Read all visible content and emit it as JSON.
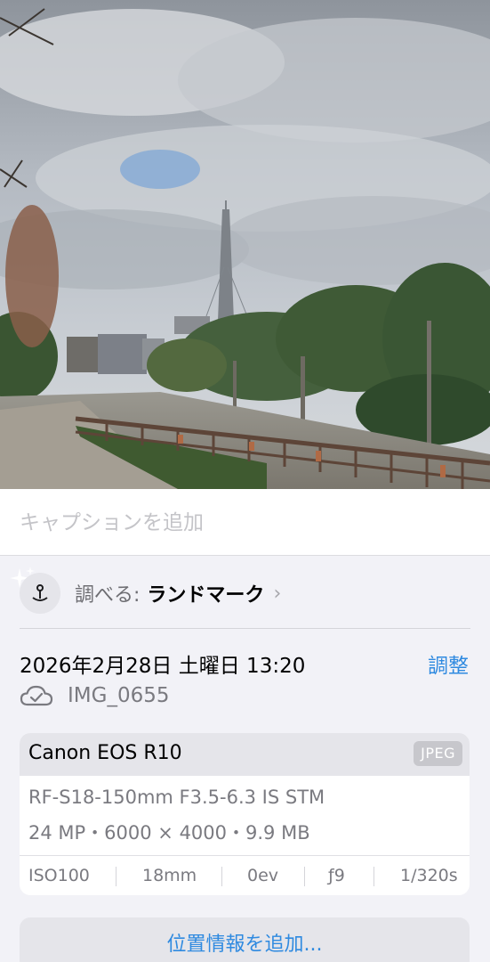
{
  "caption": {
    "placeholder": "キャプションを追加"
  },
  "lookup": {
    "prefix": "調べる:",
    "value": "ランドマーク",
    "chevron": "›",
    "icon": "landmark-pin-icon"
  },
  "metadata": {
    "datetime": "2026年2月28日 土曜日 13:20",
    "adjust_label": "調整",
    "file_name": "IMG_0655",
    "sync_icon": "icloud-icon"
  },
  "camera": {
    "model": "Canon EOS R10",
    "format": "JPEG",
    "lens": "RF-S18-150mm F3.5-6.3 IS STM",
    "specs": "24 MP・6000 × 4000・9.9 MB",
    "exif": {
      "iso": "ISO100",
      "focal_length": "18mm",
      "exposure_bias": "0ev",
      "aperture": "ƒ9",
      "shutter": "1/320s"
    }
  },
  "location": {
    "add_label": "位置情報を追加..."
  },
  "colors": {
    "accent": "#2f8ae0",
    "background": "#f2f2f7",
    "secondary_text": "#7a7a80"
  }
}
